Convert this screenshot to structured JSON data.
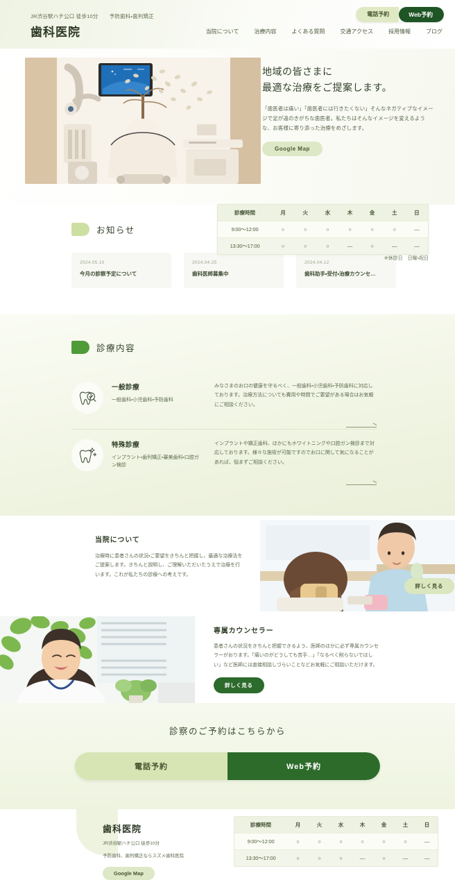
{
  "header": {
    "access": "JR渋谷駅ハチ公口 徒歩10分",
    "specialty": "予防歯科・歯列矯正",
    "title": "歯科医院",
    "nav": [
      {
        "label": "当院について"
      },
      {
        "label": "治療内容"
      },
      {
        "label": "よくある質問"
      },
      {
        "label": "交通アクセス"
      },
      {
        "label": "採用情報"
      },
      {
        "label": "ブログ"
      }
    ],
    "cta_tel": "電話予約",
    "cta_web": "Web予約"
  },
  "hero": {
    "heading_line1": "地域の皆さまに",
    "heading_line2": "最適な治療をご提案します。",
    "paragraph": "「歯医者は痛い」「歯医者には行きたくない」そんなネガティブなイメージで足が遠のきがちな歯医者。私たちはそんなイメージを変えるような、お客様に寄り添った治療をめざします。",
    "map_button": "Google Map",
    "photo_alt": "dental-treatment-room-photo"
  },
  "schedule": {
    "header": [
      "診療時間",
      "月",
      "火",
      "水",
      "木",
      "金",
      "土",
      "日"
    ],
    "rows": [
      {
        "time": "9:00〜12:00",
        "marks": [
          "○",
          "○",
          "○",
          "○",
          "○",
          "○",
          "—"
        ]
      },
      {
        "time": "13:30〜17:00",
        "marks": [
          "○",
          "○",
          "○",
          "—",
          "○",
          "—",
          "—"
        ]
      }
    ],
    "note": "※休診日　日曜・祝日"
  },
  "news": {
    "section_title": "お知らせ",
    "cards": [
      {
        "date": "2024.05.10",
        "title": "今月の診察予定について"
      },
      {
        "date": "2024.04.25",
        "title": "歯科医師募集中"
      },
      {
        "date": "2024.04.12",
        "title": "歯科助手・受付・治療カウンセ…"
      }
    ]
  },
  "treatment": {
    "section_title": "診療内容",
    "items": [
      {
        "icon": "tooth-check-icon",
        "name": "一般診療",
        "sub": "一般歯科・小児歯科・予防歯科",
        "desc": "みなさまのお口の健康を守るべく、一般歯科・小児歯科・予防歯科に対応しております。治療方法についても費用や時間でご要望がある場合はお気軽にご相談ください。"
      },
      {
        "icon": "tooth-sparkle-icon",
        "name": "特殊診療",
        "sub": "インプラント・歯列矯正・審美歯科・口腔ガン検診",
        "desc": "インプラントや矯正歯科、ほかにもホワイトニングや口腔ガン検診まで対応しております。様々な施術が可能ですのでお口に関して気になることがあれば、悩まずご相談ください。"
      }
    ]
  },
  "about": {
    "heading": "当院について",
    "paragraph": "治療時に患者さんの状況・ご要望をきちんと把握し、最適な治療法をご提案します。きちんと説明し、ご理解いただいたうえで治療を行います。これが私たちの診療への考えです。",
    "button": "詳しく見る",
    "photo_alt": "dentist-with-patient-photo"
  },
  "counselor": {
    "heading": "専属カウンセラー",
    "paragraph": "患者さんの状況をきちんと把握できるよう、医師のほかに必ず専属カウンセラーがおります。「痛いのがどうしても苦手…」「なるべく削らないでほしい」など医師には直接相談しづらいことなどお気軽にご相談いただけます。",
    "button": "詳しく見る",
    "photo_alt": "smiling-counselor-photo"
  },
  "reserve": {
    "heading": "診察のご予約はこちらから",
    "tel_label": "電話予約",
    "web_label": "Web予約"
  },
  "footer": {
    "title": "歯科医院",
    "access": "JR渋谷駅ハチ公口 徒歩10分",
    "tagline": "予防歯科、歯列矯正ならスズメ歯科医院",
    "map_button": "Google Map",
    "schedule": {
      "header": [
        "診療時間",
        "月",
        "火",
        "水",
        "木",
        "金",
        "土",
        "日"
      ],
      "rows": [
        {
          "time": "9:00〜12:00",
          "marks": [
            "○",
            "○",
            "○",
            "○",
            "○",
            "○",
            "—"
          ]
        },
        {
          "time": "13:30〜17:00",
          "marks": [
            "○",
            "○",
            "○",
            "—",
            "○",
            "—",
            "—"
          ]
        }
      ]
    }
  },
  "colors": {
    "brand_dark_green": "#1f5425",
    "brand_green": "#2d6b2a",
    "accent_light": "#dde8c6",
    "leaf_green": "#4e9b37",
    "bg_cream": "#f1f5e4"
  }
}
